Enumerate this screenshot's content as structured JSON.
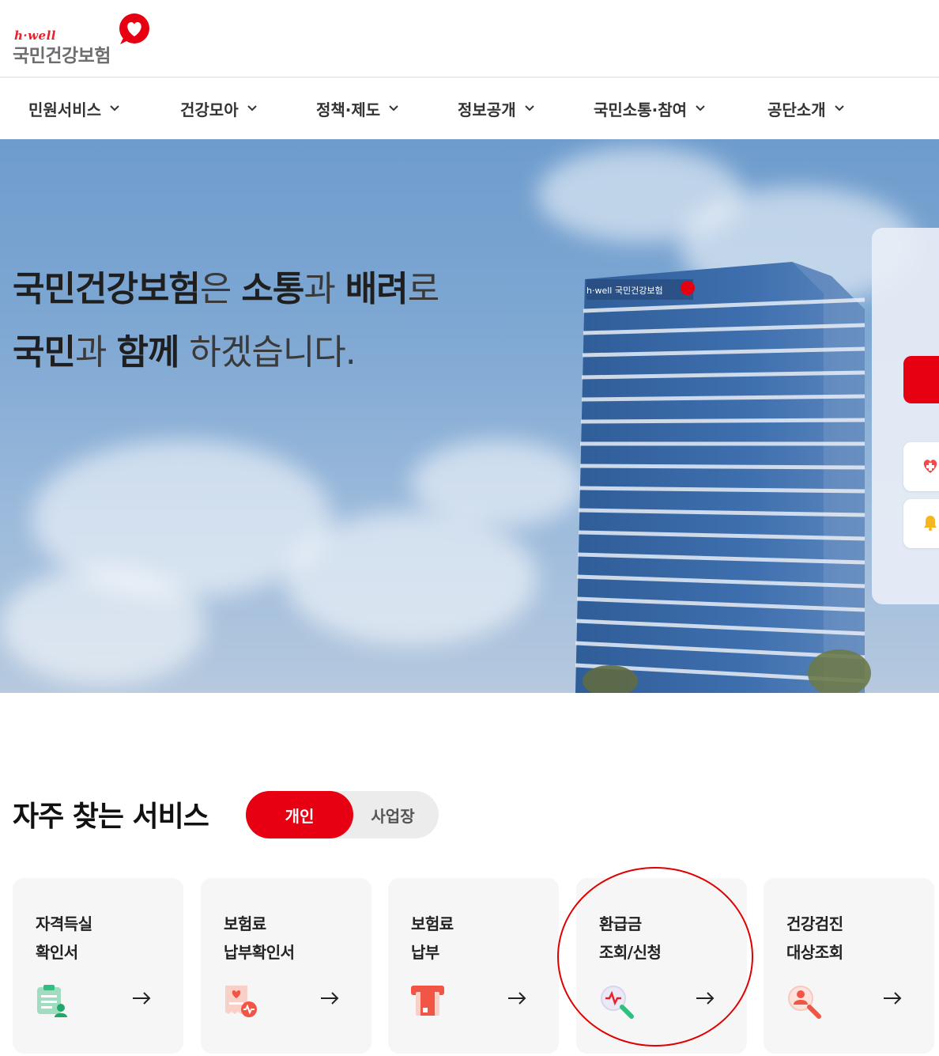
{
  "brand": {
    "logo_small": "h·well",
    "logo_main": "국민건강보험",
    "accent_color": "#e60012"
  },
  "nav": {
    "items": [
      {
        "label": "민원서비스"
      },
      {
        "label": "건강모아"
      },
      {
        "label": "정책·제도"
      },
      {
        "label": "정보공개"
      },
      {
        "label": "국민소통·참여"
      },
      {
        "label": "공단소개"
      }
    ]
  },
  "hero": {
    "line1": {
      "b1": "국민건강보험",
      "t1": "은 ",
      "b2": "소통",
      "t2": "과 ",
      "b3": "배려",
      "t3": "로"
    },
    "line2": {
      "b1": "국민",
      "t1": "과 ",
      "b2": "함께",
      "t2": " 하겠습니다."
    },
    "building_sign": "h·well 국민건강보험",
    "side_icons": [
      "heart-plus-icon",
      "bell-icon"
    ]
  },
  "services": {
    "title": "자주 찾는 서비스",
    "tabs": {
      "personal": "개인",
      "business": "사업장"
    },
    "cards": [
      {
        "title": "자격득실\n확인서",
        "icon": "document-user-icon"
      },
      {
        "title": "보험료\n납부확인서",
        "icon": "receipt-heart-icon"
      },
      {
        "title": "보험료\n납부",
        "icon": "card-payment-icon"
      },
      {
        "title": "환급금\n조회/신청",
        "icon": "search-pulse-icon"
      },
      {
        "title": "건강검진\n대상조회",
        "icon": "search-person-icon"
      }
    ],
    "arrow_glyph": "→"
  }
}
